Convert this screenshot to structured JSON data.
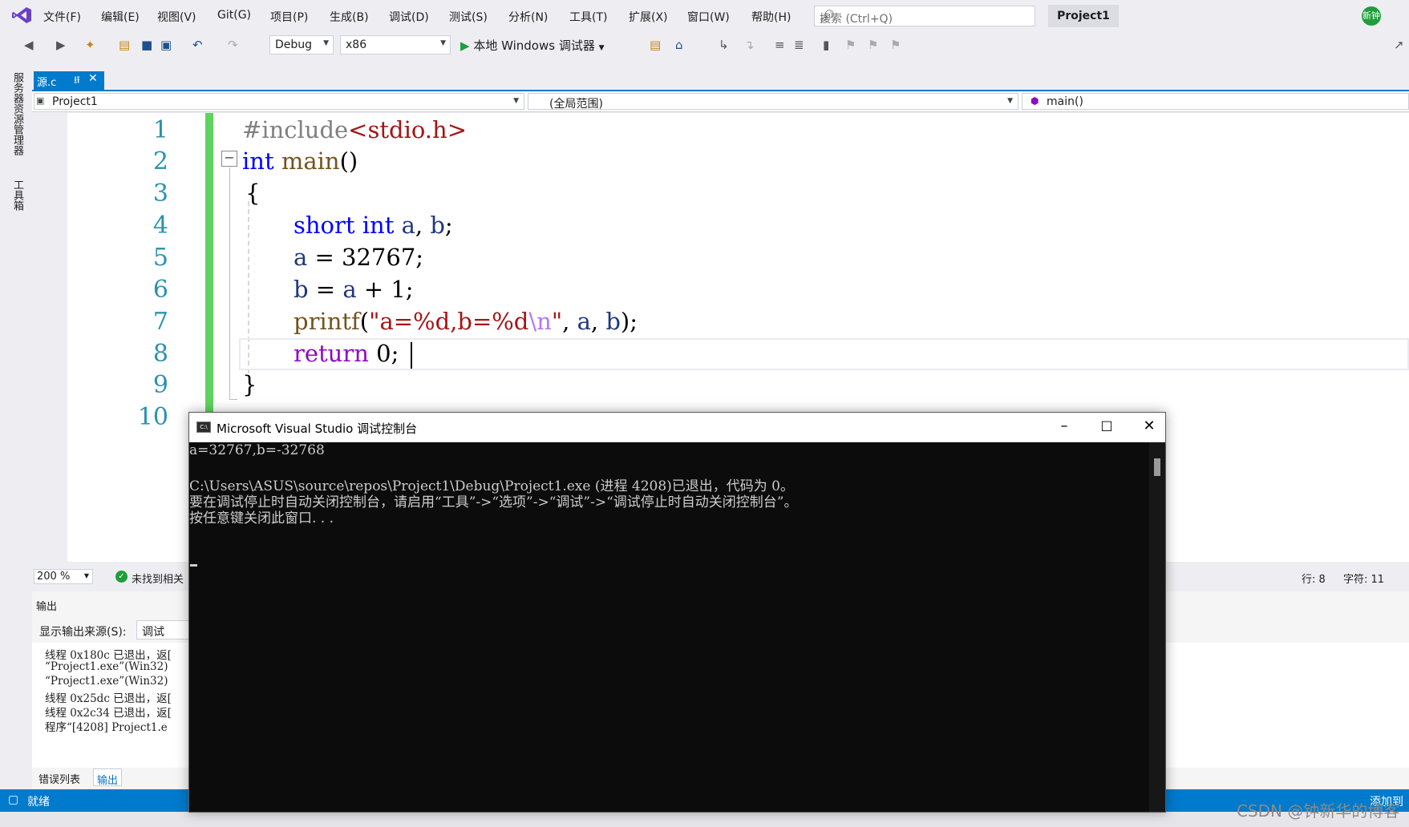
{
  "menubar": {
    "items": [
      "文件(F)",
      "编辑(E)",
      "视图(V)",
      "Git(G)",
      "项目(P)",
      "生成(B)",
      "调试(D)",
      "测试(S)",
      "分析(N)",
      "工具(T)",
      "扩展(X)",
      "窗口(W)",
      "帮助(H)"
    ],
    "search_placeholder": "搜索 (Ctrl+Q)",
    "project_name": "Project1",
    "user_initials": "新钟"
  },
  "toolbar": {
    "config": "Debug",
    "platform": "x86",
    "start_label": "本地 Windows 调试器"
  },
  "left_strip": {
    "server_explorer": "服务器资源管理器",
    "toolbox": "工具箱"
  },
  "document_tab": {
    "name": "源.c"
  },
  "nav": {
    "project": "Project1",
    "scope": "(全局范围)",
    "member": "main()"
  },
  "editor": {
    "line_numbers": [
      "1",
      "2",
      "3",
      "4",
      "5",
      "6",
      "7",
      "8",
      "9",
      "10"
    ],
    "code": {
      "l1_pp": "#include",
      "l1_hdr": "<stdio.h>",
      "l2_kw": "int",
      "l2_fn": " main",
      "l2_rest": "()",
      "l3": "{",
      "l4_kw1": "short",
      "l4_kw2": "int",
      "l4_a": "a",
      "l4_b": "b",
      "l5_a": "a",
      "l5_rest": " = 32767;",
      "l6_b": "b",
      "l6_a": "a",
      "l6_rest": " + 1;",
      "l7_fn": "printf",
      "l7_str1": "\"a=%d,b=%d",
      "l7_esc": "\\n",
      "l7_str2": "\"",
      "l7_a": "a",
      "l7_b": "b",
      "l8_kw": "return",
      "l8_rest": " 0;",
      "l9": "}"
    }
  },
  "editor_status": {
    "zoom": "200 %",
    "issues": "未找到相关",
    "line": "行: 8",
    "col": "字符: 11"
  },
  "output_panel": {
    "title": "输出",
    "source_label": "显示输出来源(S):",
    "source_value": "调试",
    "lines": [
      "线程 0x180c 已退出，返[",
      "“Project1.exe”(Win32)",
      "“Project1.exe”(Win32)",
      "线程 0x25dc 已退出，返[",
      "线程 0x2c34 已退出，返[",
      "程序“[4208] Project1.e"
    ],
    "tab_errors": "错误列表",
    "tab_output": "输出"
  },
  "statusbar": {
    "ready": "就绪",
    "add_source": "添加到"
  },
  "console": {
    "title": "Microsoft Visual Studio 调试控制台",
    "lines": [
      "a=32767,b=-32768",
      "",
      "C:\\Users\\ASUS\\source\\repos\\Project1\\Debug\\Project1.exe (进程 4208)已退出，代码为 0。",
      "要在调试停止时自动关闭控制台，请启用“工具”->“选项”->“调试”->“调试停止时自动关闭控制台”。",
      "按任意键关闭此窗口. . ."
    ]
  },
  "watermark": "CSDN @钟新华的博客"
}
